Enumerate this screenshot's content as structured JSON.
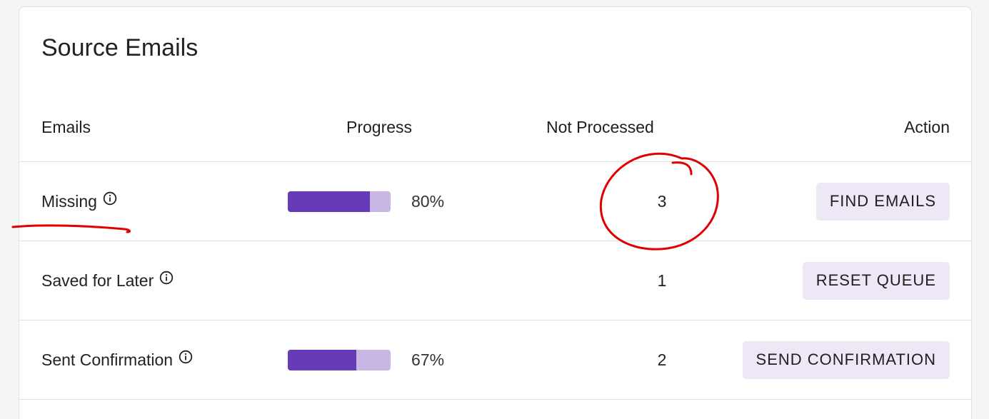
{
  "card": {
    "title": "Source Emails"
  },
  "table": {
    "headers": {
      "emails": "Emails",
      "progress": "Progress",
      "not_processed": "Not Processed",
      "action": "Action"
    },
    "rows": [
      {
        "label": "Missing",
        "progress_percent": 80,
        "progress_label": "80%",
        "not_processed": "3",
        "action_label": "FIND EMAILS"
      },
      {
        "label": "Saved for Later",
        "progress_percent": null,
        "progress_label": "",
        "not_processed": "1",
        "action_label": "RESET QUEUE"
      },
      {
        "label": "Sent Confirmation",
        "progress_percent": 67,
        "progress_label": "67%",
        "not_processed": "2",
        "action_label": "SEND CONFIRMATION"
      }
    ]
  },
  "colors": {
    "progress_fill": "#673ab7",
    "progress_track": "#c8b6e4",
    "button_bg": "#ede7f6",
    "annotation": "#e00000"
  },
  "icons": {
    "info": "info-circle-icon"
  }
}
